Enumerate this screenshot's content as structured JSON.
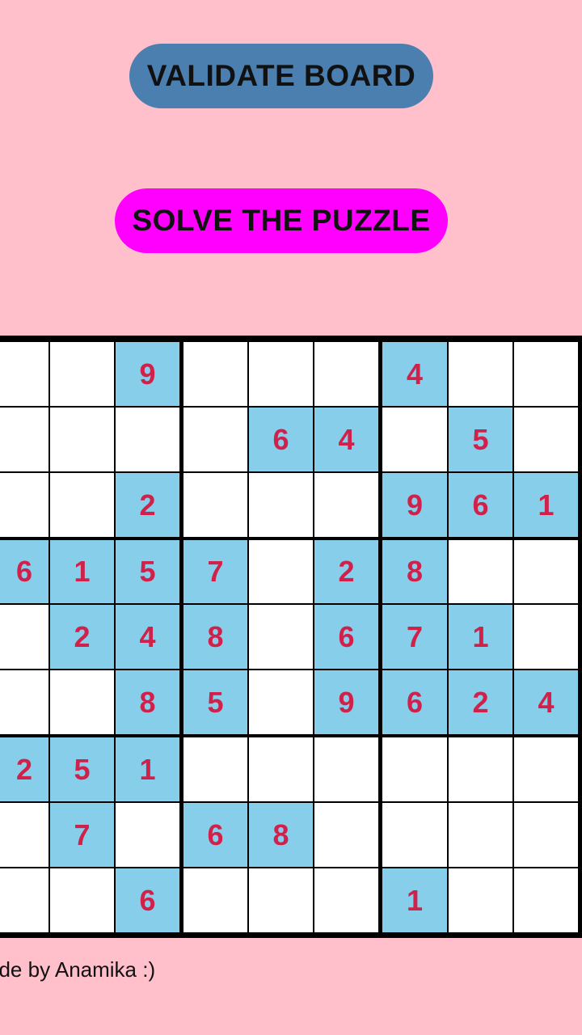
{
  "buttons": {
    "validate_label": "VALIDATE BOARD",
    "solve_label": "SOLVE THE PUZZLE"
  },
  "colors": {
    "background": "#ffc0cb",
    "validate_button": "#4a7fb0",
    "solve_button": "#ff00ff",
    "filled_cell": "#87ceeb",
    "empty_cell": "#ffffff",
    "digit": "#d0214b",
    "grid_line": "#000000"
  },
  "board": [
    [
      "",
      "",
      "9",
      "",
      "",
      "",
      "4",
      "",
      ""
    ],
    [
      "",
      "",
      "",
      "",
      "6",
      "4",
      "",
      "5",
      ""
    ],
    [
      "",
      "",
      "2",
      "",
      "",
      "",
      "9",
      "6",
      "1"
    ],
    [
      "6",
      "1",
      "5",
      "7",
      "",
      "2",
      "8",
      "",
      ""
    ],
    [
      "",
      "2",
      "4",
      "8",
      "",
      "6",
      "7",
      "1",
      ""
    ],
    [
      "",
      "",
      "8",
      "5",
      "",
      "9",
      "6",
      "2",
      "4"
    ],
    [
      "2",
      "5",
      "1",
      "",
      "",
      "",
      "",
      "",
      ""
    ],
    [
      "",
      "7",
      "",
      "6",
      "8",
      "",
      "",
      "",
      ""
    ],
    [
      "",
      "",
      "6",
      "",
      "",
      "",
      "1",
      "",
      ""
    ]
  ],
  "footer": {
    "text": "ade by Anamika :)"
  }
}
